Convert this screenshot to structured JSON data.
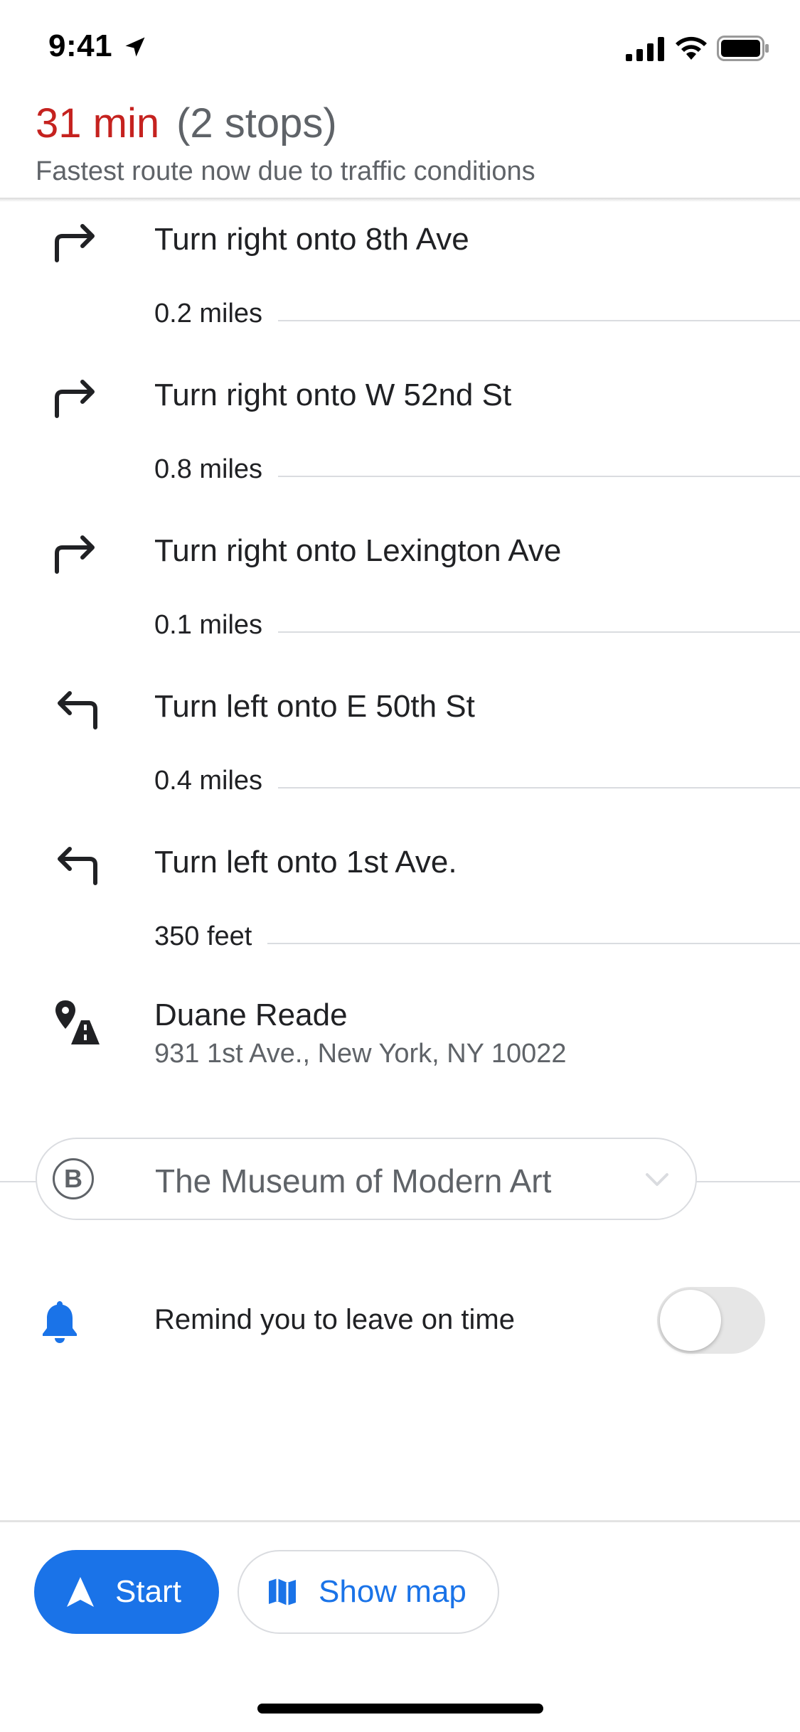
{
  "status_bar": {
    "time": "9:41"
  },
  "header": {
    "duration": "31 min",
    "stops": "(2 stops)",
    "subtitle": "Fastest route now due to traffic conditions"
  },
  "steps": [
    {
      "instruction": "Turn right onto 8th Ave",
      "distance": "0.2 miles",
      "icon": "turn-right-icon"
    },
    {
      "instruction": "Turn right onto W 52nd St",
      "distance": "0.8 miles",
      "icon": "turn-right-icon"
    },
    {
      "instruction": "Turn right onto Lexington Ave",
      "distance": "0.1 miles",
      "icon": "turn-right-icon"
    },
    {
      "instruction": "Turn left onto E 50th St",
      "distance": "0.4 miles",
      "icon": "turn-left-icon"
    },
    {
      "instruction": "Turn left onto 1st Ave.",
      "distance": "350 feet",
      "icon": "turn-left-icon"
    }
  ],
  "destination_a": {
    "name": "Duane Reade",
    "address": "931 1st Ave., New York, NY 10022"
  },
  "destination_b": {
    "badge": "B",
    "name": "The Museum of Modern Art"
  },
  "reminder": {
    "label": "Remind you to leave on time",
    "enabled": false
  },
  "actions": {
    "start_label": "Start",
    "show_map_label": "Show map"
  },
  "colors": {
    "accent": "#1a73e8",
    "duration": "#c5221f",
    "secondary_text": "#5f6368"
  }
}
